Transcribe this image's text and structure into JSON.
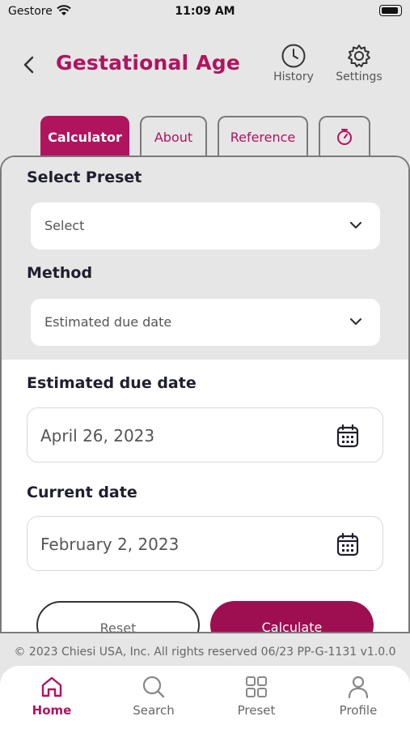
{
  "status": {
    "carrier": "Gestore",
    "time": "11:09 AM"
  },
  "header": {
    "title": "Gestational Age",
    "history_label": "History",
    "settings_label": "Settings"
  },
  "tabs": [
    {
      "label": "Calculator",
      "active": true
    },
    {
      "label": "About"
    },
    {
      "label": "Reference"
    },
    {
      "icon": "timer-icon"
    }
  ],
  "form": {
    "preset_label": "Select Preset",
    "preset_value": "Select",
    "method_label": "Method",
    "method_value": "Estimated due date",
    "due_label": "Estimated due date",
    "due_value": "April 26, 2023",
    "current_label": "Current date",
    "current_value": "February 2, 2023",
    "reset_label": "Reset",
    "calculate_label": "Calculate"
  },
  "footer": {
    "text": "© 2023 Chiesi USA, Inc. All rights reserved 06/23 PP-G-1131 v1.0.0"
  },
  "nav": [
    {
      "label": "Home",
      "icon": "home-icon",
      "active": true
    },
    {
      "label": "Search",
      "icon": "search-icon"
    },
    {
      "label": "Preset",
      "icon": "grid-icon"
    },
    {
      "label": "Profile",
      "icon": "user-icon"
    }
  ],
  "colors": {
    "brand": "#b0145f",
    "button": "#9e0f52"
  }
}
